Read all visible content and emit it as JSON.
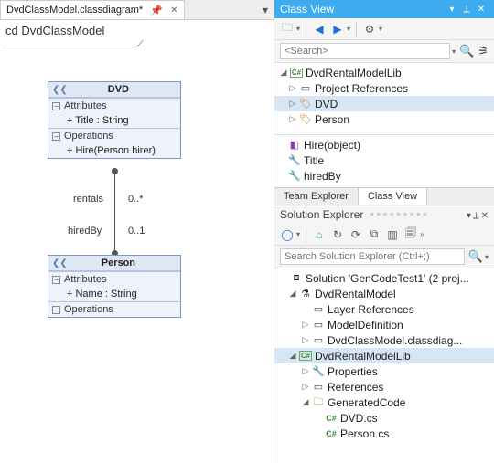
{
  "editor": {
    "tab_title": "DvdClassModel.classdiagram*",
    "cd_title": "cd DvdClassModel"
  },
  "uml": {
    "dvd": {
      "name": "DVD",
      "attr_header": "Attributes",
      "attr1": "+ Title : String",
      "ops_header": "Operations",
      "op1": "+ Hire(Person hirer)"
    },
    "person": {
      "name": "Person",
      "attr_header": "Attributes",
      "attr1": "+ Name : String",
      "ops_header": "Operations"
    },
    "assoc": {
      "role1": "rentals",
      "mult1": "0..*",
      "role2": "hiredBy",
      "mult2": "0..1"
    }
  },
  "class_view": {
    "title": "Class View",
    "search_placeholder": "<Search>",
    "tree": {
      "root": "DvdRentalModelLib",
      "n1": "Project References",
      "n2": "DVD",
      "n3": "Person"
    },
    "members": {
      "m1": "Hire(object)",
      "m2": "Title",
      "m3": "hiredBy"
    },
    "tabs": {
      "t1": "Team Explorer",
      "t2": "Class View"
    }
  },
  "solution_explorer": {
    "title": "Solution Explorer",
    "search_placeholder": "Search Solution Explorer (Ctrl+;)",
    "root": "Solution 'GenCodeTest1' (2 proj...",
    "p1": "DvdRentalModel",
    "p1_c1": "Layer References",
    "p1_c2": "ModelDefinition",
    "p1_c3": "DvdClassModel.classdiag...",
    "p2": "DvdRentalModelLib",
    "p2_c1": "Properties",
    "p2_c2": "References",
    "p2_c3": "GeneratedCode",
    "p2_c3_f1": "DVD.cs",
    "p2_c3_f2": "Person.cs"
  }
}
